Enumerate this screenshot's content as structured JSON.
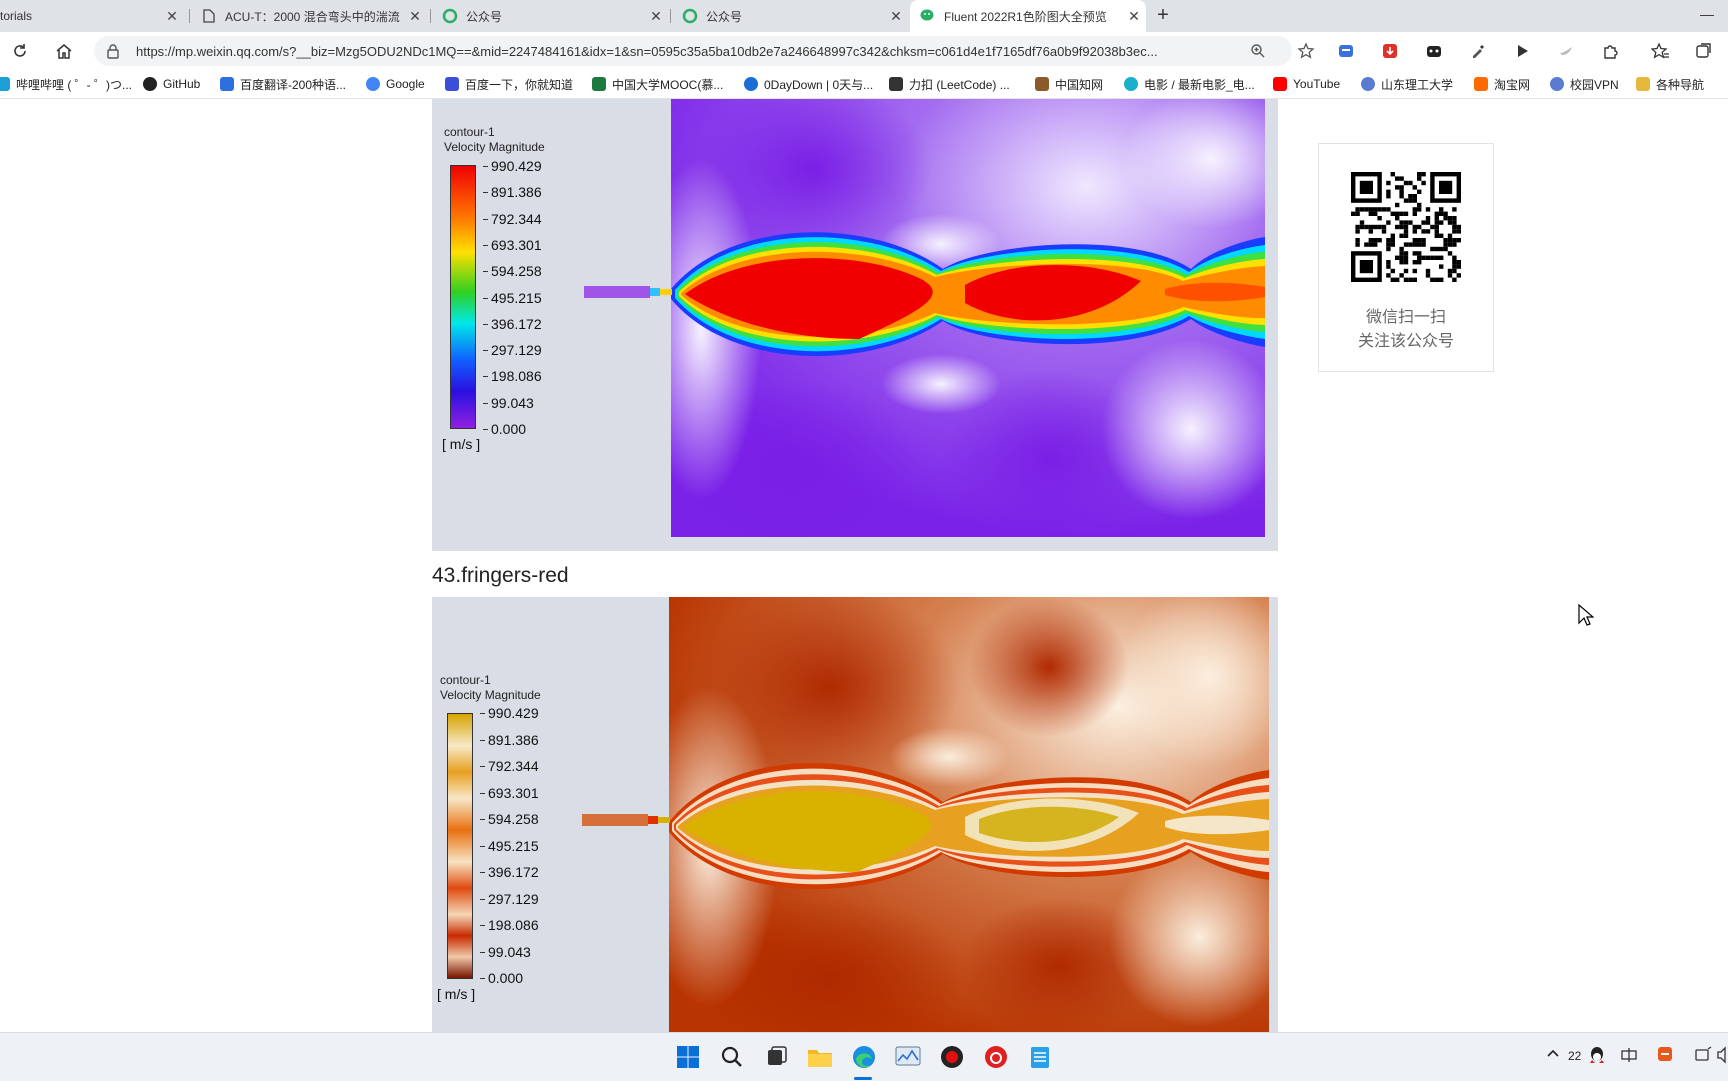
{
  "tabs": [
    {
      "title": "torials",
      "icon": "none"
    },
    {
      "title": "ACU-T：2000 混合弯头中的湍流",
      "icon": "page-icon"
    },
    {
      "title": "公众号",
      "icon": "wechat-mp-icon"
    },
    {
      "title": "公众号",
      "icon": "wechat-mp-icon"
    },
    {
      "title": "Fluent 2022R1色阶图大全预览",
      "icon": "wechat-icon",
      "active": true
    }
  ],
  "address": {
    "url": "https://mp.weixin.qq.com/s?__biz=Mzg5ODU2NDc1MQ==&mid=2247484161&idx=1&sn=0595c35a5ba10db2e7a246648997c342&chksm=c061d4e1f7165df76a0b9f92038b3ec..."
  },
  "bookmarks": [
    {
      "label": "哔哩哔哩 ( ゜- ゜)つ...",
      "icon": "bilibili-icon",
      "color": "#1e9fd6"
    },
    {
      "label": "GitHub",
      "icon": "github-icon",
      "color": "#222222"
    },
    {
      "label": "百度翻译-200种语...",
      "icon": "baidu-translate-icon",
      "color": "#2e6fe0"
    },
    {
      "label": "Google",
      "icon": "google-icon",
      "color": "#4285f4"
    },
    {
      "label": "百度一下，你就知道",
      "icon": "baidu-icon",
      "color": "#3a4ed8"
    },
    {
      "label": "中国大学MOOC(慕...",
      "icon": "mooc-icon",
      "color": "#1d7a3f"
    },
    {
      "label": "0DayDown | 0天与...",
      "icon": "odaydown-icon",
      "color": "#1a6ed6"
    },
    {
      "label": "力扣 (LeetCode) ...",
      "icon": "leetcode-icon",
      "color": "#333333"
    },
    {
      "label": "中国知网",
      "icon": "cnki-icon",
      "color": "#8a5a2a"
    },
    {
      "label": "电影 / 最新电影_电...",
      "icon": "movie-icon",
      "color": "#1bb0c9"
    },
    {
      "label": "YouTube",
      "icon": "youtube-icon",
      "color": "#ff0000"
    },
    {
      "label": "山东理工大学",
      "icon": "sdut-icon",
      "color": "#5a7bd0"
    },
    {
      "label": "淘宝网",
      "icon": "taobao-icon",
      "color": "#ff6a00"
    },
    {
      "label": "校园VPN",
      "icon": "vpn-icon",
      "color": "#5a7bd0"
    },
    {
      "label": "各种导航",
      "icon": "folder-icon",
      "color": "#e8b83c"
    }
  ],
  "figure1": {
    "legend_title_1": "contour-1",
    "legend_title_2": "Velocity Magnitude",
    "ticks": [
      "990.429",
      "891.386",
      "792.344",
      "693.301",
      "594.258",
      "495.215",
      "396.172",
      "297.129",
      "198.086",
      "99.043",
      "0.000"
    ],
    "unit": "[ m/s ]",
    "colormap": [
      "#f00000",
      "#ff7a00",
      "#ffe000",
      "#30d020",
      "#00e8e8",
      "#1060ff",
      "#2a10e0",
      "#9020e0"
    ]
  },
  "section_heading": "43.fringers-red",
  "figure2": {
    "legend_title_1": "contour-1",
    "legend_title_2": "Velocity Magnitude",
    "ticks": [
      "990.429",
      "891.386",
      "792.344",
      "693.301",
      "594.258",
      "495.215",
      "396.172",
      "297.129",
      "198.086",
      "99.043",
      "0.000"
    ],
    "unit": "[ m/s ]",
    "colormap": [
      "#d8a400",
      "#f7e8c8",
      "#e06a10",
      "#f7e2c2",
      "#cc2a00",
      "#f4d7b8",
      "#7a1400"
    ]
  },
  "qr": {
    "line1": "微信扫一扫",
    "line2": "关注该公众号"
  },
  "taskbar": {
    "tray_number": "22"
  }
}
